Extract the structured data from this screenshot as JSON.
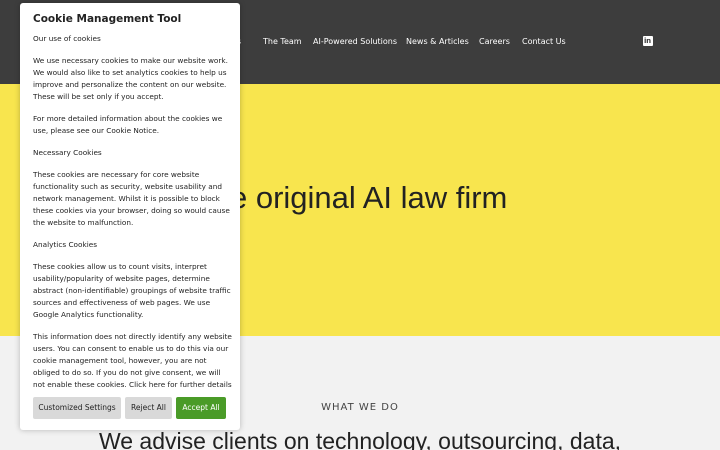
{
  "header": {
    "nav_items": [
      {
        "label": "as"
      },
      {
        "label": "The Team"
      },
      {
        "label": "AI-Powered Solutions"
      },
      {
        "label": "News & Articles"
      },
      {
        "label": "Careers"
      },
      {
        "label": "Contact Us"
      }
    ],
    "social_icon": "linkedin-icon",
    "social_glyph": "in"
  },
  "hero": {
    "title": "e original AI law firm",
    "background": "#f8e54e"
  },
  "section": {
    "eyebrow": "WHAT WE DO",
    "heading": "We advise clients on technology, outsourcing, data,"
  },
  "cookie_dialog": {
    "title": "Cookie Management Tool",
    "paragraphs": [
      "Our use of cookies",
      "We use necessary cookies to make our website work. We would also like to set analytics cookies to help us improve and personalize the content on our website. These will be set only if you accept.",
      "For more detailed information about the cookies we use, please see our Cookie Notice.",
      "Necessary Cookies",
      "These cookies are necessary for core website functionality such as security, website usability and network management. Whilst it is possible to block these cookies via your browser, doing so would cause the website to malfunction.",
      "Analytics Cookies",
      "These cookies allow us to count visits, interpret usability/popularity of website pages, determine abstract (non-identifiable) groupings of website traffic sources and effectiveness of web pages. We use Google Analytics functionality.",
      "This information does not directly identify any website users. You can consent to enable us to do this via our cookie management tool, however, you are not obliged to do so. If you do not give consent, we will not enable these cookies. Click here for further details"
    ],
    "buttons": {
      "customize": "Customized Settings",
      "reject": "Reject All",
      "accept": "Accept All"
    },
    "accept_color": "#4a9b28"
  }
}
